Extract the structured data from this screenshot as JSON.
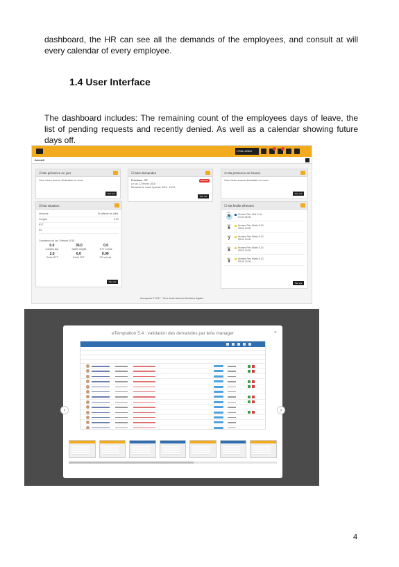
{
  "page": {
    "paragraph1": "dashboard, the HR can see all the demands of the employees, and consult at will every calendar of every employee.",
    "section_heading": "1.4 User Interface",
    "paragraph2": "The dashboard includes: The remaining count of the employees days of leave, the list of pending requests and recently denied. As well as a calendar showing future days off.",
    "page_number": "4"
  },
  "dashboard": {
    "user_name": "LYNN LUNDA",
    "subbar_label": "Accueil",
    "tout_voir": "Tout voir",
    "card_presence_jour": {
      "title": "Ma présence en jour",
      "text": "Vous n'avez aucune déclaration en cours"
    },
    "card_demandes": {
      "title": "Mes demandes",
      "item_title": "Précision - CP",
      "item_date": "Le lun. 12 février 2018",
      "item_sub": "Demandé le mardi 2 janvier 2018 - 15:32",
      "status": "Refusée"
    },
    "card_presence_heures": {
      "title": "Ma présence en heures",
      "text": "Vous n'avez aucune déclaration en cours"
    },
    "card_situation": {
      "title": "Ma situation",
      "rows": [
        {
          "label": "Absence",
          "value": "En attente de Valid."
        },
        {
          "label": "Congés",
          "value": "0.00"
        },
        {
          "label": "RTT",
          "value": ""
        },
        {
          "label": "RC",
          "value": ""
        }
      ],
      "counters_label": "Compteurs du lun. 5 février 2018",
      "counters": [
        {
          "value": "0.0",
          "label": "Congés acq"
        },
        {
          "value": "35.0",
          "label": "Solde congés"
        },
        {
          "value": "0.0",
          "label": "RTT Cumul"
        },
        {
          "value": "2.0",
          "label": "Solde RTT"
        },
        {
          "value": "0.0",
          "label": "Solde CET"
        },
        {
          "value": "0.00",
          "label": "CD calculé"
        }
      ]
    },
    "card_feuille": {
      "title": "Ma feuille d'heures",
      "days": [
        {
          "dow": "lun.",
          "num": "5",
          "event": "Horaire Flex Nuit 21-6",
          "time": "21:00 06:00"
        },
        {
          "dow": "mar.",
          "num": "6",
          "event": "Horaire Flex Matin 5-13",
          "time": "05:00 13:00"
        },
        {
          "dow": "mer.",
          "num": "7",
          "event": "Horaire Flex Matin 5-13",
          "time": "05:00 13:00"
        },
        {
          "dow": "jeu.",
          "num": "8",
          "event": "Horaire Flex Matin 5-13",
          "time": "05:00 13:00"
        },
        {
          "dow": "ven.",
          "num": "9",
          "event": "Horaire Flex Matin 5-13",
          "time": "05:00 13:00"
        }
      ]
    },
    "footer": "Horoquartz © 2017 - Tous droits réservés  Mentions légales"
  },
  "modal": {
    "title": "eTemptation 5.4 : validation des demandes par le/la manager",
    "close": "×",
    "prev": "‹",
    "next": "›",
    "row_count": 14
  },
  "colors": {
    "accent": "#f2ab1e",
    "blue": "#2f6fb1",
    "refuse": "#e53935"
  }
}
